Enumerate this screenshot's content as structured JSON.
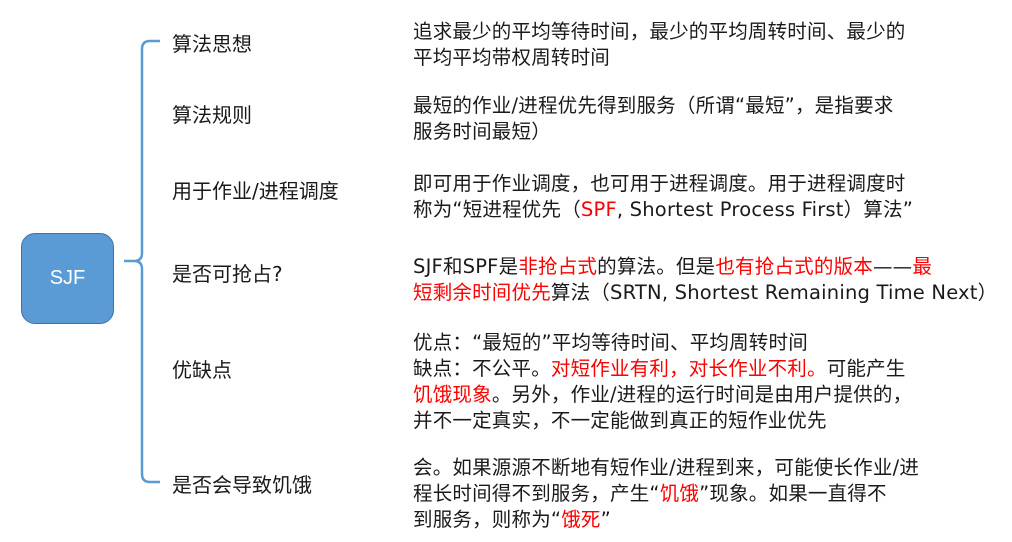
{
  "root": {
    "label": "SJF"
  },
  "branches": [
    {
      "label": "算法思想",
      "lines": [
        [
          {
            "t": "追求最少的平均等待时间，最少的平均周转时间、最少的"
          }
        ],
        [
          {
            "t": "平均平均带权周转时间"
          }
        ]
      ]
    },
    {
      "label": "算法规则",
      "lines": [
        [
          {
            "t": "最短的作业/进程优先得到服务（所谓“最短”，是指要求"
          }
        ],
        [
          {
            "t": "服务时间最短）"
          }
        ]
      ]
    },
    {
      "label": "用于作业/进程调度",
      "lines": [
        [
          {
            "t": "即可用于作业调度，也可用于进程调度。用于进程调度时"
          }
        ],
        [
          {
            "t": "称为“短进程优先（"
          },
          {
            "t": "SPF",
            "red": true
          },
          {
            "t": ", Shortest Process First）算法”"
          }
        ]
      ]
    },
    {
      "label": "是否可抢占?",
      "lines": [
        [
          {
            "t": "SJF和SPF是"
          },
          {
            "t": "非抢占式",
            "red": true
          },
          {
            "t": "的算法。但是"
          },
          {
            "t": "也有抢占式的版本",
            "red": true
          },
          {
            "t": "——"
          },
          {
            "t": "最",
            "red": true
          }
        ],
        [
          {
            "t": "短剩余时间优先",
            "red": true
          },
          {
            "t": "算法（SRTN, Shortest Remaining Time Next）"
          }
        ]
      ]
    },
    {
      "label": "优缺点",
      "lines": [
        [
          {
            "t": "优点：“最短的”平均等待时间、平均周转时间"
          }
        ],
        [
          {
            "t": "缺点：不公平。"
          },
          {
            "t": "对短作业有利，对长作业不利。",
            "red": true
          },
          {
            "t": "可能产生"
          }
        ],
        [
          {
            "t": "饥饿现象",
            "red": true
          },
          {
            "t": "。另外，作业/进程的运行时间是由用户提供的，"
          }
        ],
        [
          {
            "t": "并不一定真实，不一定能做到真正的短作业优先"
          }
        ]
      ]
    },
    {
      "label": "是否会导致饥饿",
      "lines": [
        [
          {
            "t": "会。如果源源不断地有短作业/进程到来，可能使长作业/进"
          }
        ],
        [
          {
            "t": "程长时间得不到服务，产生“"
          },
          {
            "t": "饥饿",
            "red": true
          },
          {
            "t": "”现象。如果一直得不"
          }
        ],
        [
          {
            "t": "到服务，则称为“"
          },
          {
            "t": "饿死",
            "red": true
          },
          {
            "t": "”"
          }
        ]
      ]
    }
  ],
  "colors": {
    "root_fill": "#5b9bd5",
    "brace": "#5b9bd5",
    "highlight": "#ff0000"
  }
}
